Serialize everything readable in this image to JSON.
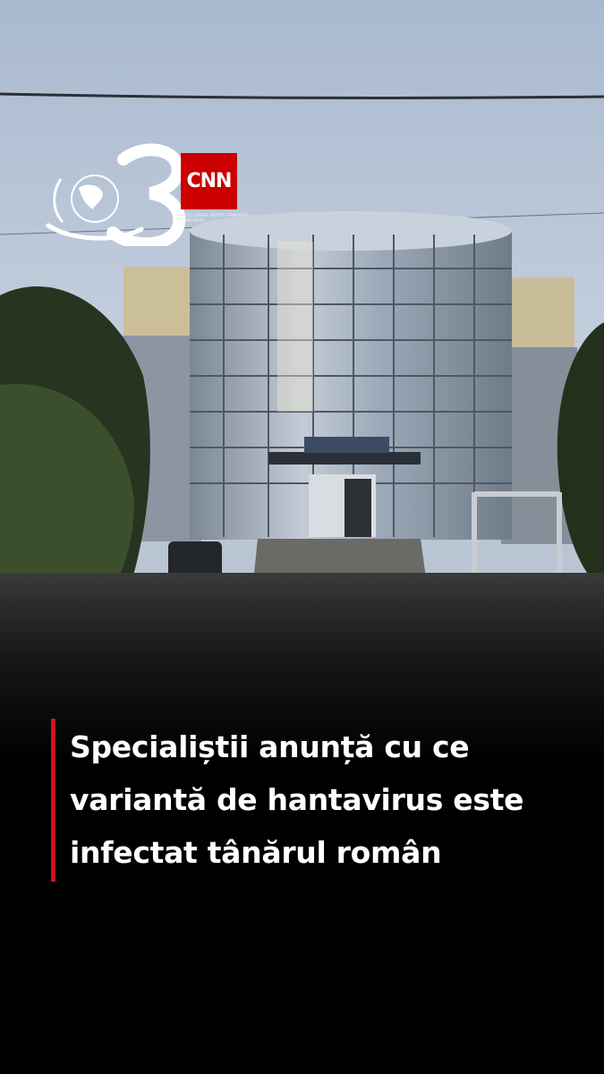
{
  "brand": {
    "channel_logo": "antena-3-globe-logo",
    "cnn_label": "CNN",
    "partner_text": "EXCLUSIVE NEWS CHANNEL PARTNER"
  },
  "headline": {
    "lines": [
      "Specialiștii anunță cu ce",
      "variantă de hantavirus este",
      "infectat tânărul român"
    ],
    "accent_color": "#d0141e"
  }
}
